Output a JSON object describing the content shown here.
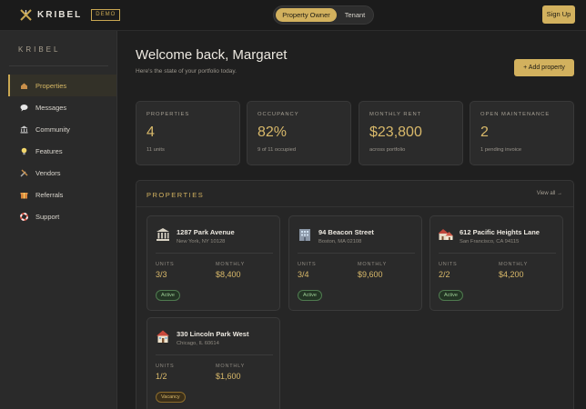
{
  "header": {
    "brand": "KRIBEL",
    "badge": "DEMO",
    "toggle": [
      "Property Owner",
      "Tenant"
    ],
    "signup": "Sign Up"
  },
  "sidebar": {
    "brand": "KRIBEL",
    "items": [
      {
        "label": "Properties",
        "icon": "home-icon"
      },
      {
        "label": "Messages",
        "icon": "speech-bubble-icon"
      },
      {
        "label": "Community",
        "icon": "building-columns-icon"
      },
      {
        "label": "Features",
        "icon": "lightbulb-icon"
      },
      {
        "label": "Vendors",
        "icon": "tools-icon"
      },
      {
        "label": "Referrals",
        "icon": "gift-icon"
      },
      {
        "label": "Support",
        "icon": "lifebuoy-icon"
      }
    ]
  },
  "main": {
    "title": "Welcome back, Margaret",
    "subtitle": "Here's the state of your portfolio today.",
    "add_button": "+ Add property",
    "stats": [
      {
        "label": "PROPERTIES",
        "value": "4",
        "sub": "11 units"
      },
      {
        "label": "OCCUPANCY",
        "value": "82%",
        "sub": "9 of 11 occupied"
      },
      {
        "label": "MONTHLY RENT",
        "value": "$23,800",
        "sub": "across portfolio"
      },
      {
        "label": "OPEN MAINTENANCE",
        "value": "2",
        "sub": "1 pending invoice"
      }
    ],
    "panel": {
      "title": "PROPERTIES",
      "view_all": "View all →",
      "units_label": "UNITS",
      "monthly_label": "MONTHLY",
      "cards": [
        {
          "name": "1287 Park Avenue",
          "city": "New York, NY 10128",
          "units": "3/3",
          "monthly": "$8,400",
          "status": "Active",
          "icon": "classical-building-icon"
        },
        {
          "name": "94 Beacon Street",
          "city": "Boston, MA 02108",
          "units": "3/4",
          "monthly": "$9,600",
          "status": "Active",
          "icon": "office-building-icon"
        },
        {
          "name": "612 Pacific Heights Lane",
          "city": "San Francisco, CA 94115",
          "units": "2/2",
          "monthly": "$4,200",
          "status": "Active",
          "icon": "houses-icon"
        },
        {
          "name": "330 Lincoln Park West",
          "city": "Chicago, IL 60614",
          "units": "1/2",
          "monthly": "$1,600",
          "status": "Vacancy",
          "icon": "house-icon"
        }
      ]
    }
  },
  "colors": {
    "accent": "#d2b15e",
    "background": "#1f1f1f",
    "sidebar": "#2a2a2a",
    "active_badge": "#9ccc94"
  }
}
